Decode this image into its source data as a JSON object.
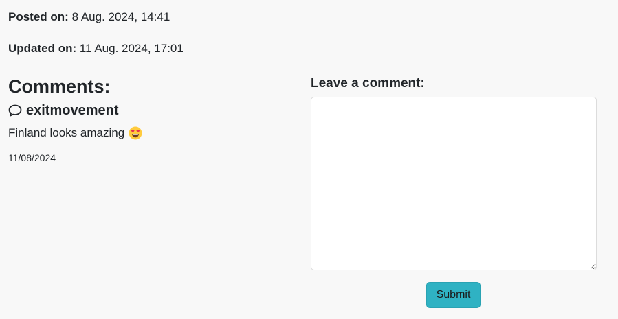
{
  "post": {
    "posted_label": "Posted on:",
    "posted_value": "8 Aug. 2024, 14:41",
    "updated_label": "Updated on:",
    "updated_value": "11 Aug. 2024, 17:01"
  },
  "comments": {
    "heading": "Comments:",
    "items": [
      {
        "author": "exitmovement",
        "author_icon": "chat-bubble-icon",
        "text": "Finland looks amazing",
        "emoji": "heart-eyes-emoji",
        "date": "11/08/2024"
      }
    ]
  },
  "comment_form": {
    "label": "Leave a comment:",
    "textarea_value": "",
    "submit_label": "Submit"
  },
  "colors": {
    "background": "#f8f8f8",
    "accent": "#2fb2c3",
    "text": "#212529"
  }
}
